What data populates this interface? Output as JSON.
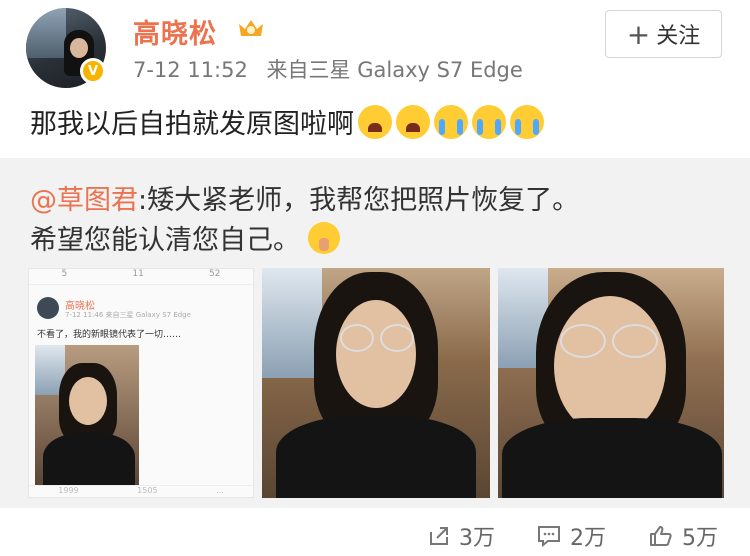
{
  "post": {
    "user_name": "高晓松",
    "time": "7-12 11:52",
    "source": "来自三星 Galaxy S7 Edge",
    "follow_label": "关注",
    "text": "那我以后自拍就发原图啦啊",
    "emojis": [
      "angry-face-icon",
      "angry-face-icon",
      "crying-face-icon",
      "crying-face-icon",
      "crying-face-icon"
    ]
  },
  "repost": {
    "mention": "@草图君",
    "line1_rest": ":矮大紧老师，我帮您把照片恢复了。",
    "line2": "希望您能认清您自己。",
    "emoji": "shush-face-icon"
  },
  "mini_post": {
    "stats": [
      "5",
      "11",
      "52"
    ],
    "user_name": "高晓松",
    "meta": "7-12 11:46  来自三星 Galaxy S7 Edge",
    "text": "不看了，我的新眼镜代表了一切……",
    "bottom_stats": [
      "1999",
      "1505",
      "..."
    ]
  },
  "actions": {
    "share_count": "3万",
    "comment_count": "2万",
    "like_count": "5万"
  },
  "colors": {
    "accent": "#eb7350",
    "repost_bg": "#f2f2f2",
    "verified": "#f7b500"
  }
}
